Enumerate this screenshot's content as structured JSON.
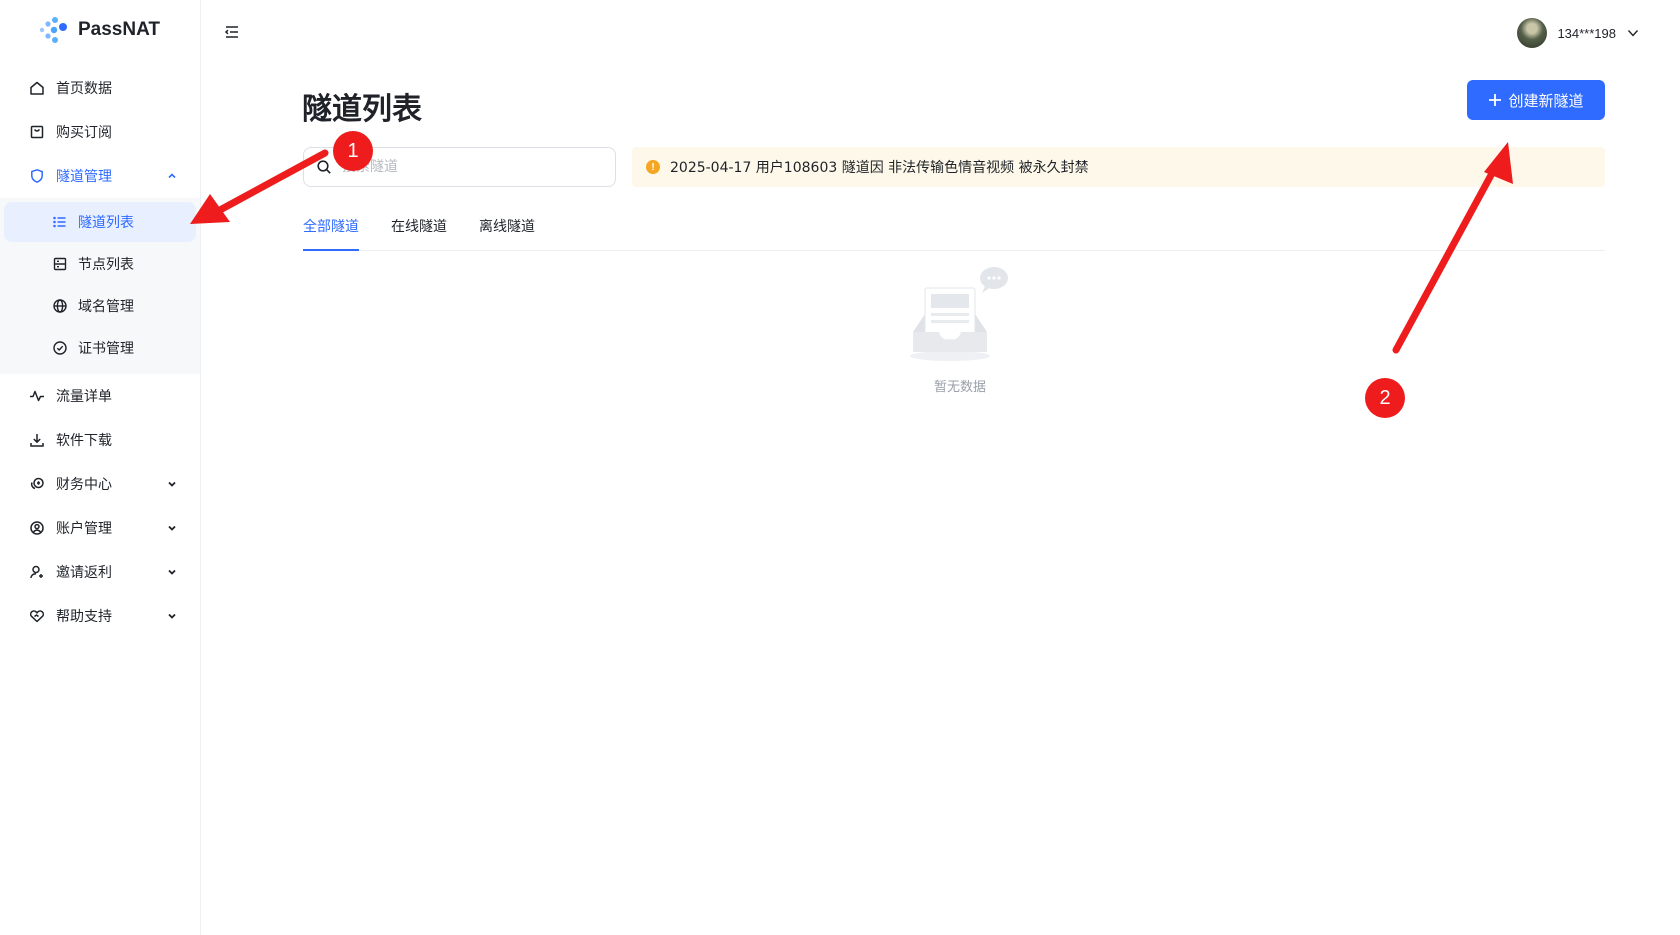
{
  "app": {
    "name": "PassNAT"
  },
  "sidebar": {
    "items": [
      {
        "label": "首页数据",
        "icon": "home-icon"
      },
      {
        "label": "购买订阅",
        "icon": "shopping-bag-icon"
      },
      {
        "label": "隧道管理",
        "icon": "shield-icon",
        "expanded": true,
        "children": [
          {
            "label": "隧道列表",
            "icon": "list-icon",
            "active": true
          },
          {
            "label": "节点列表",
            "icon": "server-icon"
          },
          {
            "label": "域名管理",
            "icon": "globe-icon"
          },
          {
            "label": "证书管理",
            "icon": "check-badge-icon"
          }
        ]
      },
      {
        "label": "流量详单",
        "icon": "activity-icon"
      },
      {
        "label": "软件下载",
        "icon": "download-icon"
      },
      {
        "label": "财务中心",
        "icon": "finance-icon",
        "expandable": true
      },
      {
        "label": "账户管理",
        "icon": "user-circle-icon",
        "expandable": true
      },
      {
        "label": "邀请返利",
        "icon": "user-plus-icon",
        "expandable": true
      },
      {
        "label": "帮助支持",
        "icon": "heart-hand-icon",
        "expandable": true
      }
    ]
  },
  "header": {
    "username": "134***198"
  },
  "main": {
    "title": "隧道列表",
    "create_button": "创建新隧道",
    "search_placeholder": "搜索隧道",
    "notice": "2025-04-17 用户108603 隧道因 非法传输色情音视频 被永久封禁",
    "tabs": [
      {
        "label": "全部隧道",
        "active": true
      },
      {
        "label": "在线隧道"
      },
      {
        "label": "离线隧道"
      }
    ],
    "empty_text": "暂无数据"
  },
  "annotations": {
    "marker_1": "1",
    "marker_2": "2"
  },
  "colors": {
    "primary": "#2f6bff",
    "annotation": "#ee1c1c",
    "notice_bg": "#fdf8e9",
    "warning": "#f5a623"
  }
}
